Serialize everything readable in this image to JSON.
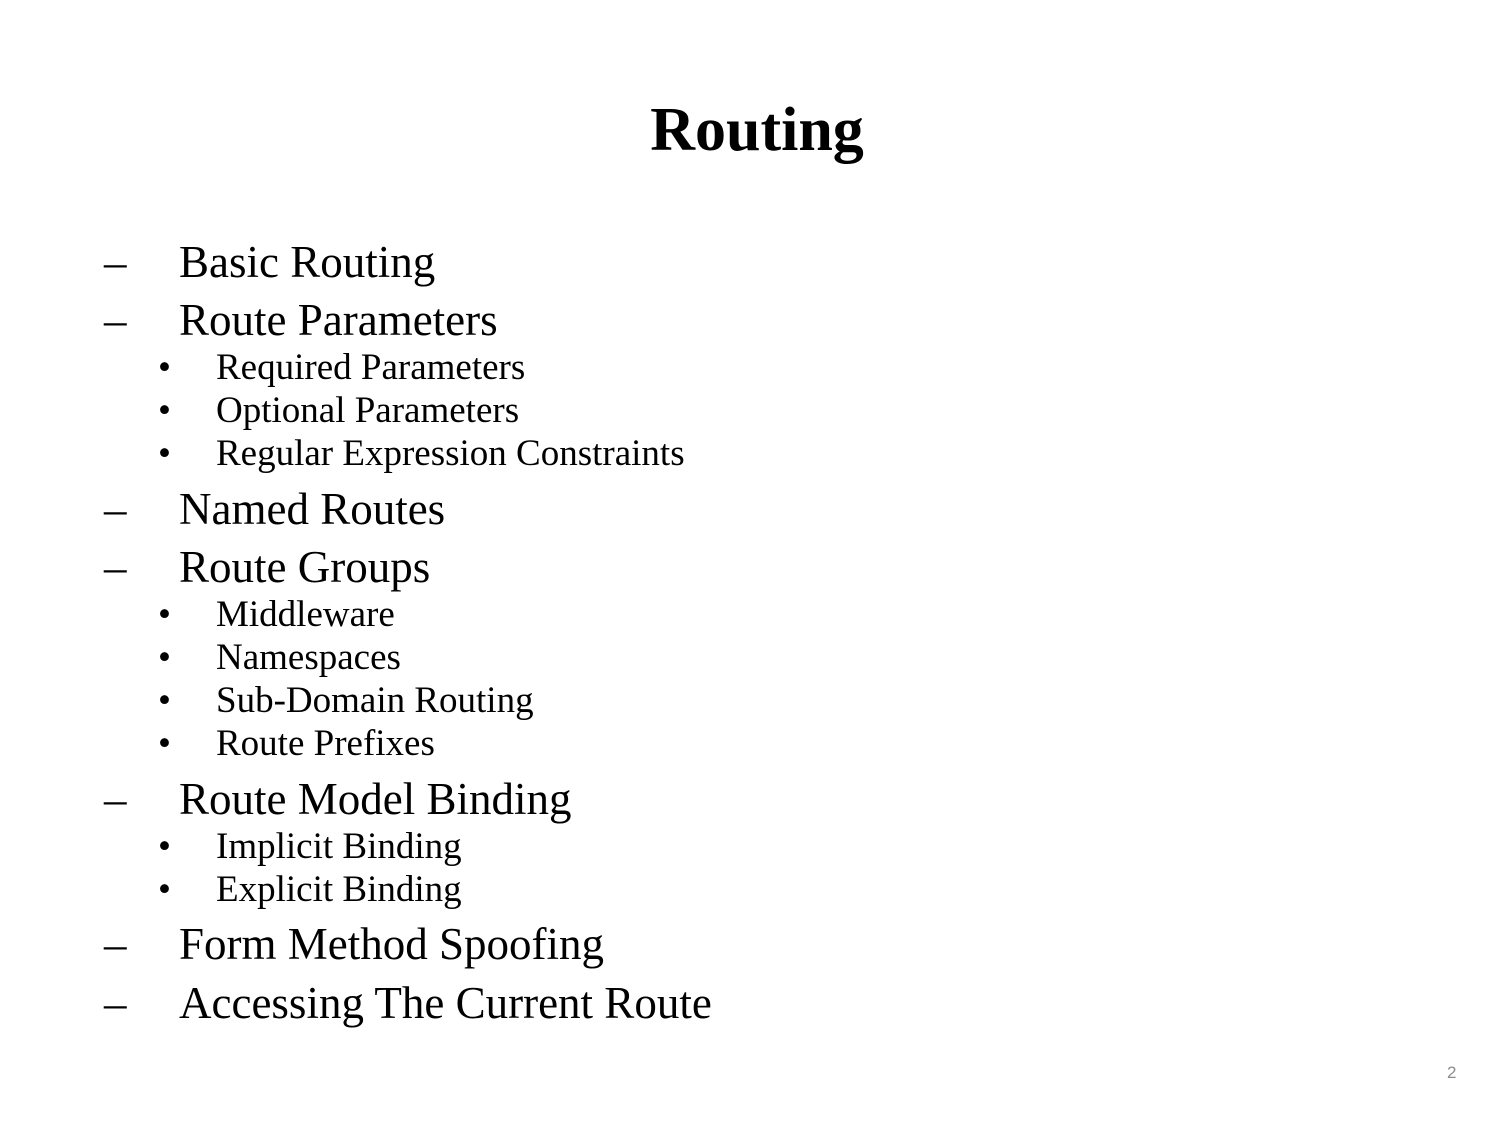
{
  "slide": {
    "title": "Routing",
    "page_number": "2",
    "level1_marker": "–",
    "level2_marker": "•",
    "items": [
      {
        "level": 1,
        "text": "Basic Routing"
      },
      {
        "level": 1,
        "text": "Route Parameters"
      },
      {
        "level": 2,
        "text": "Required Parameters"
      },
      {
        "level": 2,
        "text": "Optional Parameters"
      },
      {
        "level": 2,
        "text": "Regular Expression Constraints"
      },
      {
        "level": 1,
        "text": "Named Routes"
      },
      {
        "level": 1,
        "text": "Route Groups"
      },
      {
        "level": 2,
        "text": "Middleware"
      },
      {
        "level": 2,
        "text": "Namespaces"
      },
      {
        "level": 2,
        "text": "Sub-Domain Routing"
      },
      {
        "level": 2,
        "text": "Route Prefixes"
      },
      {
        "level": 1,
        "text": "Route Model Binding"
      },
      {
        "level": 2,
        "text": "Implicit Binding"
      },
      {
        "level": 2,
        "text": "Explicit Binding"
      },
      {
        "level": 1,
        "text": "Form Method Spoofing"
      },
      {
        "level": 1,
        "text": "Accessing The Current Route"
      }
    ]
  }
}
